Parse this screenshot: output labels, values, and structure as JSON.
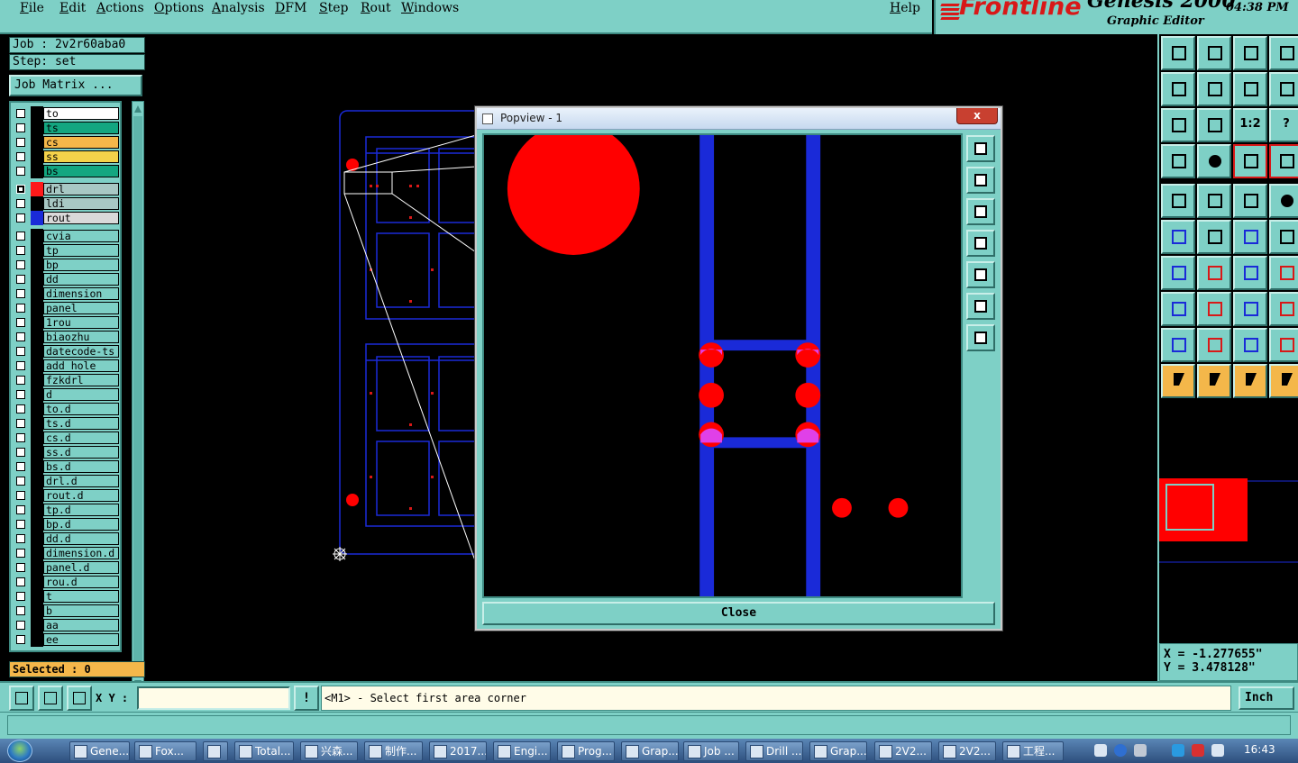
{
  "menu": [
    "File",
    "Edit",
    "Actions",
    "Options",
    "Analysis",
    "DFM",
    "Step",
    "Rout",
    "Windows"
  ],
  "help": "Help",
  "brand": {
    "logo": "Frontline",
    "product": "Genesis 2000",
    "subtitle": "Graphic Editor",
    "time": "04:38 PM"
  },
  "job": {
    "job_label": "Job : 2v2r60aba0",
    "step_label": "Step: set",
    "matrix_button": "Job Matrix ..."
  },
  "layers": [
    {
      "name": "to",
      "bg": "#ffffff",
      "color": "#000000",
      "group": 0
    },
    {
      "name": "ts",
      "bg": "#13a680",
      "color": "#000000",
      "group": 0
    },
    {
      "name": "cs",
      "bg": "#f4b74a",
      "color": "#000000",
      "group": 0
    },
    {
      "name": "ss",
      "bg": "#f4d24a",
      "color": "#000000",
      "group": 0
    },
    {
      "name": "bs",
      "bg": "#13a680",
      "color": "#000000",
      "group": 0
    },
    {
      "name": "drl",
      "bg": "#a8c8c4",
      "color": "#ff1a1a",
      "group": 1,
      "selected": true
    },
    {
      "name": "ldi",
      "bg": "#a8c8c4",
      "color": "#000000",
      "group": 1
    },
    {
      "name": "rout",
      "bg": "#d9d9d9",
      "color": "#1a2ad8",
      "group": 1
    },
    {
      "name": "cvia",
      "bg": "#7ed0c6",
      "color": "#000000",
      "group": 2
    },
    {
      "name": "tp",
      "bg": "#7ed0c6",
      "color": "#000000",
      "group": 2
    },
    {
      "name": "bp",
      "bg": "#7ed0c6",
      "color": "#000000",
      "group": 2
    },
    {
      "name": "dd",
      "bg": "#7ed0c6",
      "color": "#000000",
      "group": 2
    },
    {
      "name": "dimension",
      "bg": "#7ed0c6",
      "color": "#000000",
      "group": 2
    },
    {
      "name": "panel",
      "bg": "#7ed0c6",
      "color": "#000000",
      "group": 2
    },
    {
      "name": "1rou",
      "bg": "#7ed0c6",
      "color": "#000000",
      "group": 2
    },
    {
      "name": "biaozhu",
      "bg": "#7ed0c6",
      "color": "#000000",
      "group": 2
    },
    {
      "name": "datecode-ts",
      "bg": "#7ed0c6",
      "color": "#000000",
      "group": 2
    },
    {
      "name": "add_hole",
      "bg": "#7ed0c6",
      "color": "#000000",
      "group": 2
    },
    {
      "name": "fzkdrl",
      "bg": "#7ed0c6",
      "color": "#000000",
      "group": 2
    },
    {
      "name": "d",
      "bg": "#7ed0c6",
      "color": "#000000",
      "group": 2
    },
    {
      "name": "to.d",
      "bg": "#7ed0c6",
      "color": "#000000",
      "group": 2
    },
    {
      "name": "ts.d",
      "bg": "#7ed0c6",
      "color": "#000000",
      "group": 2
    },
    {
      "name": "cs.d",
      "bg": "#7ed0c6",
      "color": "#000000",
      "group": 2
    },
    {
      "name": "ss.d",
      "bg": "#7ed0c6",
      "color": "#000000",
      "group": 2
    },
    {
      "name": "bs.d",
      "bg": "#7ed0c6",
      "color": "#000000",
      "group": 2
    },
    {
      "name": "drl.d",
      "bg": "#7ed0c6",
      "color": "#000000",
      "group": 2
    },
    {
      "name": "rout.d",
      "bg": "#7ed0c6",
      "color": "#000000",
      "group": 2
    },
    {
      "name": "tp.d",
      "bg": "#7ed0c6",
      "color": "#000000",
      "group": 2
    },
    {
      "name": "bp.d",
      "bg": "#7ed0c6",
      "color": "#000000",
      "group": 2
    },
    {
      "name": "dd.d",
      "bg": "#7ed0c6",
      "color": "#000000",
      "group": 2
    },
    {
      "name": "dimension.d",
      "bg": "#7ed0c6",
      "color": "#000000",
      "group": 2
    },
    {
      "name": "panel.d",
      "bg": "#7ed0c6",
      "color": "#000000",
      "group": 2
    },
    {
      "name": "rou.d",
      "bg": "#7ed0c6",
      "color": "#000000",
      "group": 2
    },
    {
      "name": "t",
      "bg": "#7ed0c6",
      "color": "#000000",
      "group": 2
    },
    {
      "name": "b",
      "bg": "#7ed0c6",
      "color": "#000000",
      "group": 2
    },
    {
      "name": "aa",
      "bg": "#7ed0c6",
      "color": "#000000",
      "group": 2
    },
    {
      "name": "ee",
      "bg": "#7ed0c6",
      "color": "#000000",
      "group": 2
    }
  ],
  "selected_count": "Selected : 0",
  "popview": {
    "title": "Popview - 1",
    "close_x": "x",
    "close_button": "Close"
  },
  "coords": {
    "x": "X = -1.277655\"",
    "y": "Y = 3.478128\""
  },
  "cmd": {
    "xy_label": "X Y :",
    "xy_value": "",
    "prompt": "<M1> - Select first area corner",
    "units": "Inch",
    "alert": "!"
  },
  "taskbar": {
    "tasks": [
      "Gene...",
      "Fox...",
      "",
      "Total...",
      "兴森...",
      "制作...",
      "2017...",
      "Engi...",
      "Prog...",
      "Grap...",
      "Job ...",
      "Drill ...",
      "Grap...",
      "2V2...",
      "2V2...",
      "工程..."
    ],
    "clock": "16:43"
  },
  "colors": {
    "panel": "#7ed0c6",
    "drill_red": "#ff0000",
    "rout_blue": "#1a2ad8",
    "overlap_magenta": "#e040e8"
  }
}
